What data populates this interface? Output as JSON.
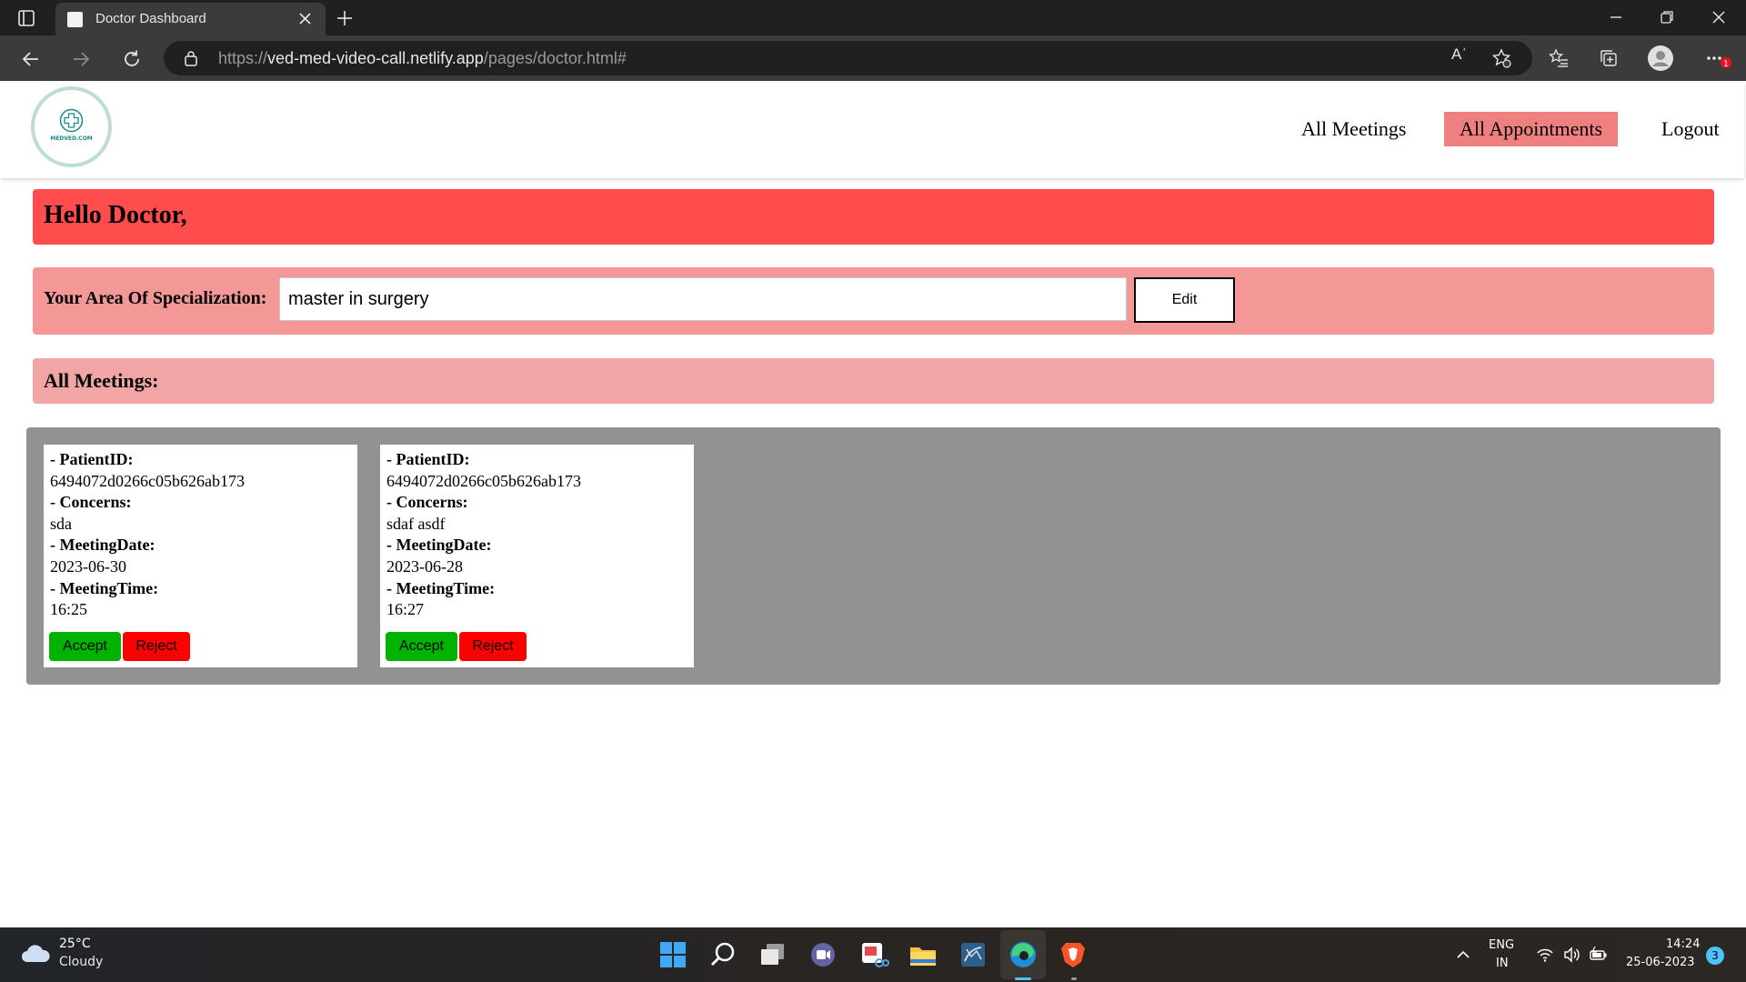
{
  "browser": {
    "tab_title": "Doctor Dashboard",
    "url_scheme": "https://",
    "url_host": "ved-med-video-call.netlify.app",
    "url_path": "/pages/doctor.html#",
    "read_aloud_label": "Aʾ",
    "menu_badge": "1"
  },
  "header": {
    "logo_text": "MEDVED.COM",
    "nav": {
      "all_meetings": "All Meetings",
      "all_appointments": "All Appointments",
      "logout": "Logout"
    },
    "active_color": "#f08080"
  },
  "greeting": "Hello Doctor,",
  "specialization": {
    "label": "Your Area Of Specialization:",
    "value": "master in surgery",
    "edit_label": "Edit"
  },
  "meetings_heading": "All Meetings:",
  "meeting_labels": {
    "patient_id": "- PatientID:",
    "concerns": "- Concerns:",
    "meeting_date": "- MeetingDate:",
    "meeting_time": "- MeetingTime:",
    "accept": "Accept",
    "reject": "Reject"
  },
  "meetings": [
    {
      "patient_id": "6494072d0266c05b626ab173",
      "concerns": "sda",
      "meeting_date": "2023-06-30",
      "meeting_time": "16:25"
    },
    {
      "patient_id": "6494072d0266c05b626ab173",
      "concerns": "sdaf asdf",
      "meeting_date": "2023-06-28",
      "meeting_time": "16:27"
    }
  ],
  "colors": {
    "greeting_bg": "#ff4c4c",
    "spec_bg": "#f49797",
    "meetings_heading_bg": "#f1a5a5",
    "container_bg": "#929294",
    "accept": "#00b300",
    "reject": "#ff0000"
  },
  "taskbar": {
    "weather_temp": "25°C",
    "weather_desc": "Cloudy",
    "lang_primary": "ENG",
    "lang_secondary": "IN",
    "time": "14:24",
    "date": "25-06-2023",
    "notification_count": "3"
  }
}
